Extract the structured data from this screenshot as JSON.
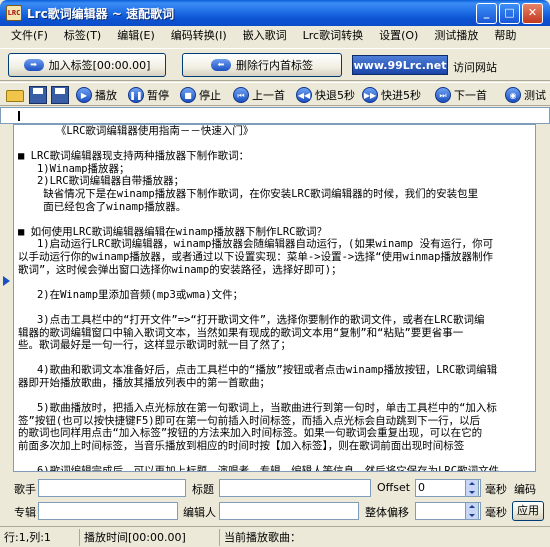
{
  "window": {
    "app_icon_text": "LRC",
    "title": "Lrc歌词编辑器 ~ 速配歌词",
    "minimize": "_",
    "maximize": "□",
    "close": "✕"
  },
  "menu": [
    "文件(F)",
    "标签(T)",
    "编辑(E)",
    "编码转换(I)",
    "嵌入歌词",
    "Lrc歌词转换",
    "设置(O)",
    "测试播放",
    "帮助"
  ],
  "row2": {
    "add_tag": "加入标签[00:00.00]",
    "delete_tags": "删除行内首标签",
    "site": "www.99Lrc.net",
    "visit": "访问网站"
  },
  "toolbar": {
    "play": "播放",
    "pause": "暂停",
    "stop": "停止",
    "prev": "上一首",
    "rewind": "快退5秒",
    "forward": "快进5秒",
    "next": "下一首",
    "test": "测试"
  },
  "editor_lines": [
    "      《LRC歌词编辑器使用指南－－快速入门》",
    "",
    "■ LRC歌词编辑器现支持两种播放器下制作歌词：",
    "   1)Winamp播放器；",
    "   2)LRC歌词编辑器自带播放器；",
    "    缺省情况下是在winamp播放器下制作歌词，在你安装LRC歌词编辑器的时候，我们的安装包里",
    "    面已经包含了winamp播放器。",
    "",
    "■ 如何使用LRC歌词编辑器编辑在winamp播放器下制作LRC歌词？",
    "   1)启动运行LRC歌词编辑器，winamp播放器会随编辑器自动运行，(如果winamp 没有运行，你可",
    "以手动运行你的winamp播放器，或者通过以下设置实现：菜单->设置->选择“使用winmap播放器制作",
    "歌词”，这时候会弹出窗口选择你winamp的安装路径，选择好即可)；",
    "",
    "   2)在Winamp里添加音频(mp3或wma)文件；",
    "",
    "   3)点击工具栏中的“打开文件”=>“打开歌词文件”，选择你要制作的歌词文件，或者在LRC歌词编",
    "辑器的歌词编辑窗口中输入歌词文本，当然如果有现成的歌词文本用“复制”和“粘贴”要更省事一",
    "些。歌词最好是一句一行，这样显示歌词时就一目了然了；",
    "",
    "   4)歌曲和歌词文本准备好后，点击工具栏中的“播放”按钮或者点击winamp播放按钮，LRC歌词编辑",
    "器即开始播放歌曲，播放其播放列表中的第一首歌曲；",
    "",
    "   5)歌曲播放时，把插入点光标放在第一句歌词上，当歌曲进行到第一句时，单击工具栏中的“加入标",
    "签”按钮(也可以按快捷键F5)即可在第一句前插入时间标签，而插入点光标会自动跳到下一行，以后",
    "的歌词也同样用点击“加入标签”按钮的方法来加入时间标签。如果一句歌词会重复出现，可以在它的",
    "前面多次加上时间标签，当音乐播放到相应的时间时按【加入标签】，则在歌词前面出现时间标签",
    "",
    "   6)歌词编辑完成后，可以再加上标题、演唱者、专辑、编辑人等信息，然后将它保存为LRC歌词文件。"
  ],
  "form": {
    "singer_label": "歌手",
    "singer_value": "",
    "title_label": "标题",
    "title_value": "",
    "offset_label": "Offset",
    "offset_value": "0",
    "ms_label_1": "毫秒",
    "encode_label": "编码",
    "album_label": "专辑",
    "album_value": "",
    "editor_label": "编辑人",
    "editor_value": "",
    "global_offset_label": "整体偏移",
    "global_offset_value": "",
    "ms_label_2": "毫秒",
    "apply": "应用"
  },
  "status": {
    "position": "行:1,列:1",
    "play_time": "播放时间[00:00.00]",
    "current_song": "当前播放歌曲："
  }
}
